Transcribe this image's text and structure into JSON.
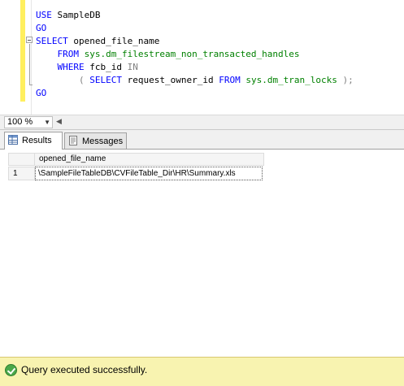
{
  "editor": {
    "lines": [
      [
        "USE",
        "SampleDB"
      ],
      [
        "GO"
      ],
      [
        "SELECT",
        "opened_file_name"
      ],
      [
        "FROM",
        "sys.dm_filestream_non_transacted_handles"
      ],
      [
        "WHERE",
        "fcb_id",
        "IN"
      ],
      [
        "(",
        "SELECT",
        "request_owner_id",
        "FROM",
        "sys.dm_tran_locks",
        ");"
      ],
      [
        "GO"
      ]
    ]
  },
  "zoom": {
    "value": "100 %"
  },
  "tabs": {
    "results": "Results",
    "messages": "Messages"
  },
  "grid": {
    "columns": [
      "opened_file_name"
    ],
    "rows": [
      {
        "num": "1",
        "cells": [
          "\\SampleFileTableDB\\CVFileTable_Dir\\HR\\Summary.xls"
        ]
      }
    ]
  },
  "status": {
    "text": "Query executed successfully."
  },
  "colors": {
    "keyword": "#0000ff",
    "system": "#008000",
    "operator": "#808080",
    "changebar": "#ffef5e",
    "statusbar": "#f8f3b0"
  }
}
